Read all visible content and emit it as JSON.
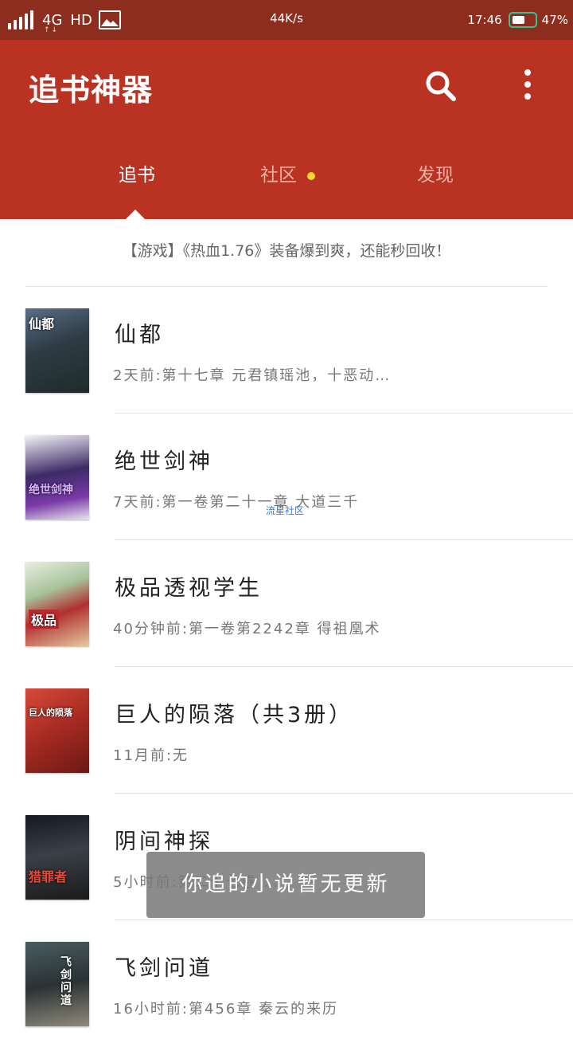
{
  "status_bar": {
    "network": "4G",
    "hd": "HD",
    "speed": "44K/s",
    "time": "17:46",
    "battery": "47%"
  },
  "app": {
    "title": "追书神器",
    "icons": {
      "search": "search-icon",
      "more": "more-vertical-icon"
    }
  },
  "tabs": [
    {
      "label": "追书"
    },
    {
      "label": "社区"
    },
    {
      "label": "发现"
    }
  ],
  "notice": "【游戏】《热血1.76》装备爆到爽，还能秒回收！",
  "books": [
    {
      "title": "仙都",
      "update": "2天前:第十七章 元君镇瑶池，十恶动…",
      "cover_text": "仙都"
    },
    {
      "title": "绝世剑神",
      "update": "7天前:第一卷第二十一章 大道三千",
      "cover_text": "绝世剑神"
    },
    {
      "title": "极品透视学生",
      "update": "40分钟前:第一卷第2242章 得祖凰术",
      "cover_text": "极品"
    },
    {
      "title": "巨人的陨落（共3册）",
      "update": "11月前:无",
      "cover_text": "巨人的陨落"
    },
    {
      "title": "阴间神探",
      "update": "5小时前:第二十七卷 …",
      "cover_text": "猎罪者"
    },
    {
      "title": "飞剑问道",
      "update": "16小时前:第456章 秦云的来历",
      "cover_text": "飞剑问道"
    }
  ],
  "watermark": "流星社区",
  "toast": "你追的小说暂无更新"
}
